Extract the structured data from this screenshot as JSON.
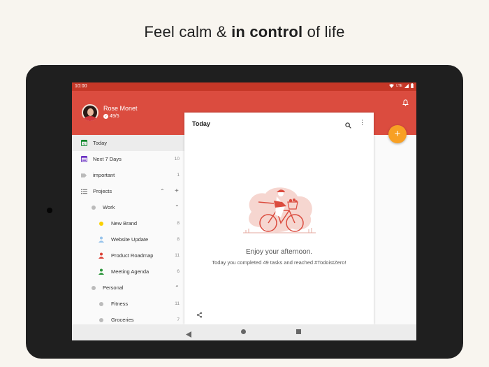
{
  "headline": {
    "prefix": "Feel calm & ",
    "bold": "in control",
    "suffix": " of life"
  },
  "status": {
    "time": "10:00",
    "network": "LTE"
  },
  "user": {
    "name": "Rose Monet",
    "karma": "49/5"
  },
  "colors": {
    "brand_red": "#db4c3f",
    "fab": "#f8a024",
    "today_green": "#058527",
    "next7_purple": "#692fc2"
  },
  "sidebar": {
    "today": {
      "label": "Today",
      "icon": "calendar-today-icon"
    },
    "next7": {
      "label": "Next 7 Days",
      "count": "10",
      "icon": "calendar-week-icon"
    },
    "important": {
      "label": "important",
      "count": "1",
      "icon": "label-tag-icon"
    },
    "projects": {
      "label": "Projects",
      "icon": "list-icon"
    },
    "work": {
      "label": "Work"
    },
    "new_brand": {
      "label": "New Brand",
      "count": "8"
    },
    "website_update": {
      "label": "Website Update",
      "count": "8"
    },
    "product_roadmap": {
      "label": "Product Roadmap",
      "count": "11"
    },
    "meeting_agenda": {
      "label": "Meeting Agenda",
      "count": "6"
    },
    "personal": {
      "label": "Personal"
    },
    "fitness": {
      "label": "Fitness",
      "count": "11"
    },
    "groceries": {
      "label": "Groceries",
      "count": "7"
    }
  },
  "panel": {
    "title": "Today",
    "empty_title": "Enjoy your afternoon.",
    "empty_sub": "Today you completed 49 tasks and reached #TodoistZero!"
  }
}
